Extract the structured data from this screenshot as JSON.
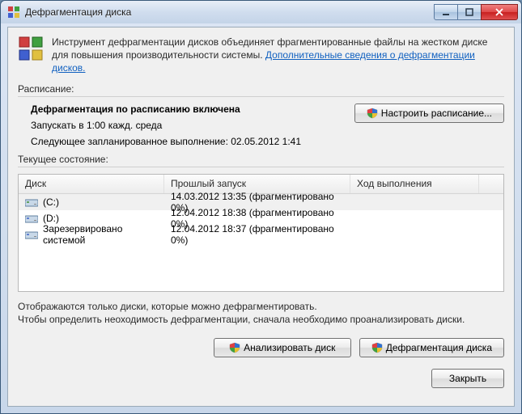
{
  "window": {
    "title": "Дефрагментация диска"
  },
  "info": {
    "text_before_link": "Инструмент дефрагментации дисков объединяет фрагментированные файлы на жестком диске для повышения производительности системы. ",
    "link": "Дополнительные сведения о дефрагментации дисков."
  },
  "schedule": {
    "label": "Расписание:",
    "status": "Дефрагментация по расписанию включена",
    "run_at": "Запускать в 1:00 кажд. среда",
    "next_run": "Следующее запланированное выполнение: 02.05.2012 1:41",
    "configure_btn": "Настроить расписание..."
  },
  "current": {
    "label": "Текущее состояние:",
    "headers": {
      "disk": "Диск",
      "last": "Прошлый запуск",
      "progress": "Ход выполнения"
    },
    "rows": [
      {
        "name": "(C:)",
        "last": "14.03.2012 13:35 (фрагментировано 0%)",
        "icon": "hdd"
      },
      {
        "name": "(D:)",
        "last": "12.04.2012 18:38 (фрагментировано 0%)",
        "icon": "hdd"
      },
      {
        "name": "Зарезервировано системой",
        "last": "12.04.2012 18:37 (фрагментировано 0%)",
        "icon": "hdd"
      }
    ]
  },
  "note": {
    "line1": "Отображаются только диски, которые можно дефрагментировать.",
    "line2": "Чтобы определить неоходимость  дефрагментации, сначала необходимо проанализировать диски."
  },
  "buttons": {
    "analyze": "Анализировать диск",
    "defrag": "Дефрагментация диска",
    "close": "Закрыть"
  }
}
